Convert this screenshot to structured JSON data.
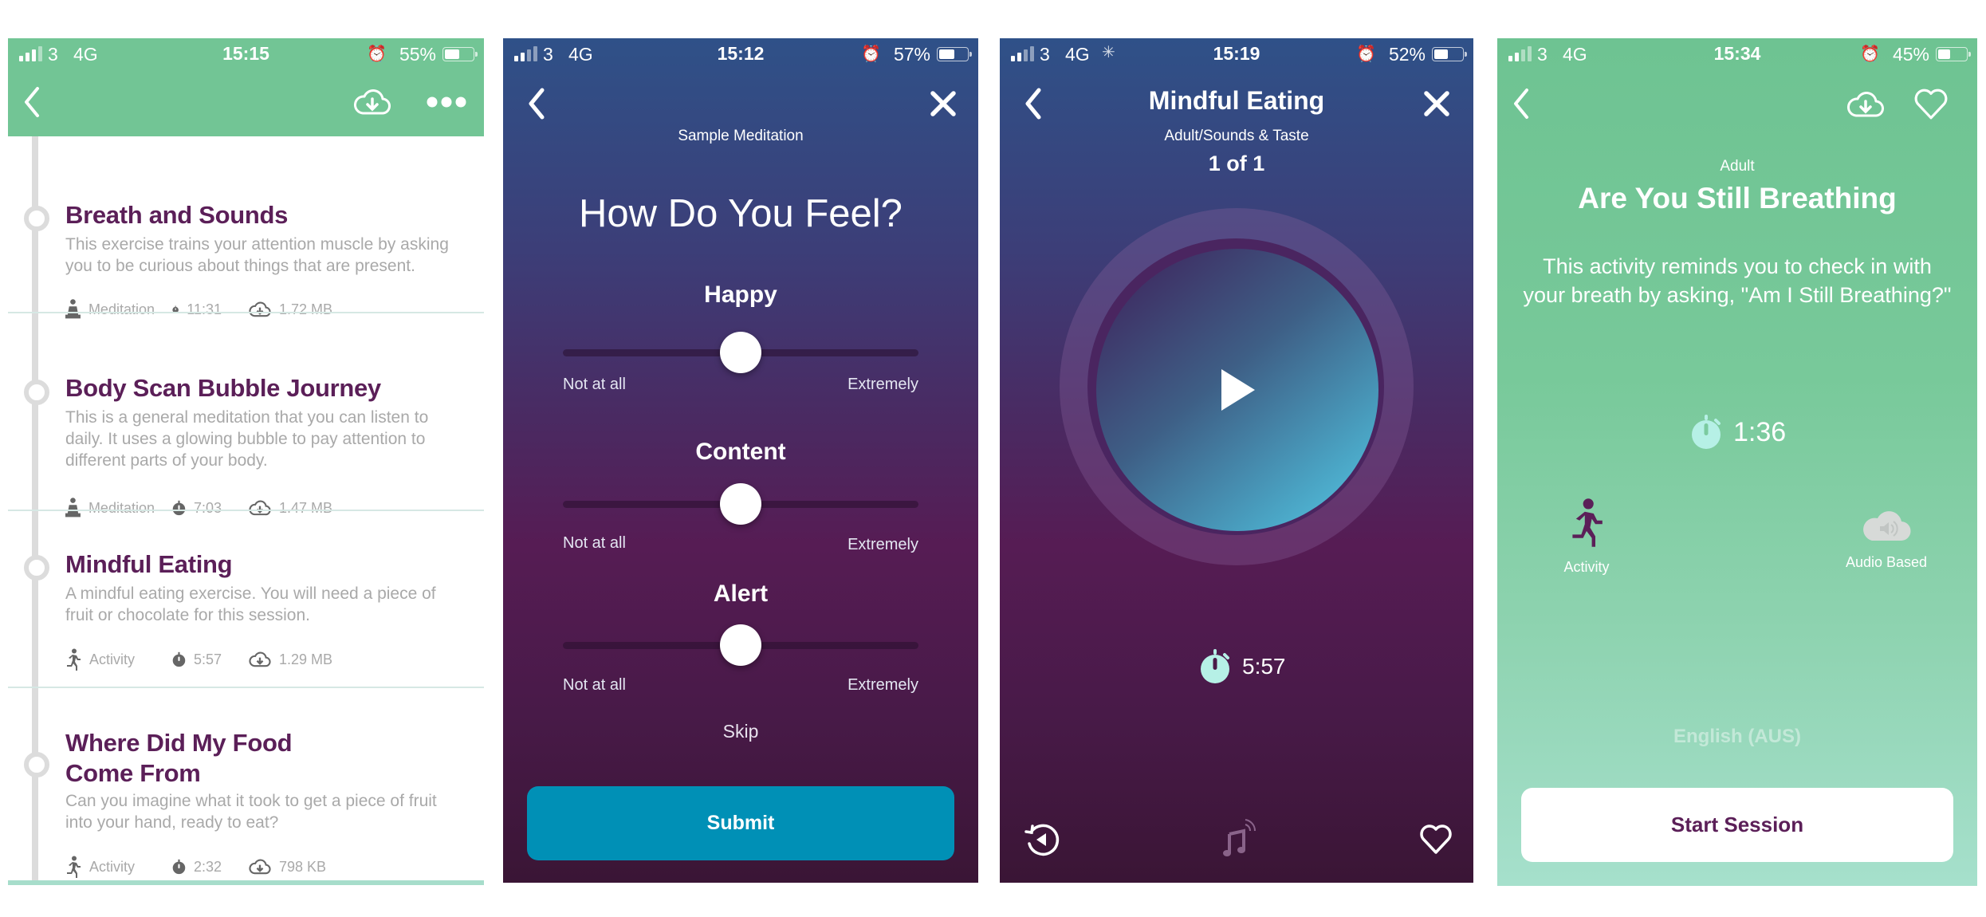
{
  "colors": {
    "brand_green": "#72c595",
    "brand_purple": "#5b1f58",
    "submit_blue": "#0090b6",
    "timer_mint": "#b6f0e6"
  },
  "screens": [
    {
      "status": {
        "carrier": "3",
        "network": "4G",
        "time": "15:15",
        "battery": "55%",
        "battery_level": 0.55
      },
      "header": {
        "back_icon": "chevron-left-icon",
        "download_icon": "cloud-download-icon",
        "more_icon": "more-dots-icon"
      },
      "items": [
        {
          "title": "Breath and Sounds",
          "description": "This exercise trains your attention muscle by asking you to be curious about things that are present.",
          "type": "Meditation",
          "type_icon": "meditation-icon",
          "duration": "11:31",
          "size": "1.72 MB"
        },
        {
          "title": "Body Scan Bubble Journey",
          "description": "This is a general meditation that you can listen to daily. It uses a glowing bubble to pay attention to different parts of your body.",
          "type": "Meditation",
          "type_icon": "meditation-icon",
          "duration": "7:03",
          "size": "1.47 MB"
        },
        {
          "title": "Mindful Eating",
          "description": "A mindful eating exercise. You will need a piece of fruit or chocolate for this session.",
          "type": "Activity",
          "type_icon": "running-icon",
          "duration": "5:57",
          "size": "1.29 MB"
        },
        {
          "title": "Where Did My Food Come From",
          "description": "Can you imagine what it took to get a piece of fruit into your hand, ready to eat?",
          "type": "Activity",
          "type_icon": "running-icon",
          "duration": "2:32",
          "size": "798 KB"
        }
      ]
    },
    {
      "status": {
        "carrier": "3",
        "network": "4G",
        "time": "15:12",
        "battery": "57%",
        "battery_level": 0.57
      },
      "subtitle": "Sample Meditation",
      "question": "How Do You Feel?",
      "sliders": [
        {
          "label": "Happy",
          "min_label": "Not at all",
          "max_label": "Extremely",
          "value": 0.5
        },
        {
          "label": "Content",
          "min_label": "Not at all",
          "max_label": "Extremely",
          "value": 0.5
        },
        {
          "label": "Alert",
          "min_label": "Not at all",
          "max_label": "Extremely",
          "value": 0.5
        }
      ],
      "skip_label": "Skip",
      "submit_label": "Submit"
    },
    {
      "status": {
        "carrier": "3",
        "network": "4G",
        "time": "15:19",
        "battery": "52%",
        "battery_level": 0.52
      },
      "title": "Mindful Eating",
      "breadcrumb": "Adult/Sounds & Taste",
      "track_count": "1 of 1",
      "duration": "5:57"
    },
    {
      "status": {
        "carrier": "3",
        "network": "4G",
        "time": "15:34",
        "battery": "45%",
        "battery_level": 0.45
      },
      "category": "Adult",
      "title": "Are You Still Breathing",
      "description": "This activity reminds you to check in with your breath by asking, \"Am I Still Breathing?\"",
      "duration": "1:36",
      "features": [
        {
          "label": "Activity",
          "icon": "running-icon"
        },
        {
          "label": "Audio Based",
          "icon": "cloud-audio-icon"
        }
      ],
      "language": "English (AUS)",
      "start_label": "Start Session"
    }
  ]
}
